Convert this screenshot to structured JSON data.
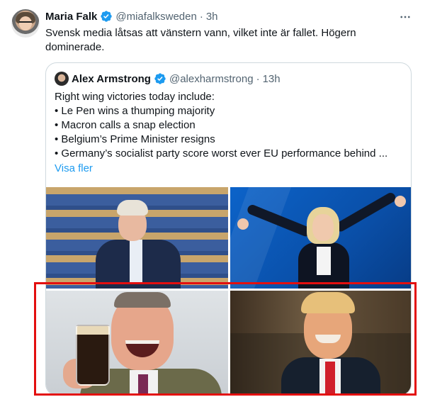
{
  "tweet": {
    "author_name": "Maria Falk",
    "author_handle": "@miafalksweden",
    "separator": "·",
    "time": "3h",
    "text": "Svensk media låtsas att vänstern vann, vilket inte är fallet. Högern dominerade.",
    "more_icon": "more-horizontal-icon"
  },
  "quote": {
    "author_name": "Alex Armstrong",
    "author_handle": "@alexharmstrong",
    "separator": "·",
    "time": "13h",
    "lines": [
      "Right wing victories today include:",
      "• Le Pen wins a thumping majority",
      "• Macron calls a snap election",
      "• Belgium’s Prime Minister resigns",
      "• Germany’s socialist party score worst ever EU performance behind ..."
    ],
    "show_more": "Visa fler"
  },
  "colors": {
    "accent": "#1d9bf0",
    "verified": "#1d9bf0",
    "highlight": "#e30f0f",
    "secondary_text": "#536471"
  }
}
